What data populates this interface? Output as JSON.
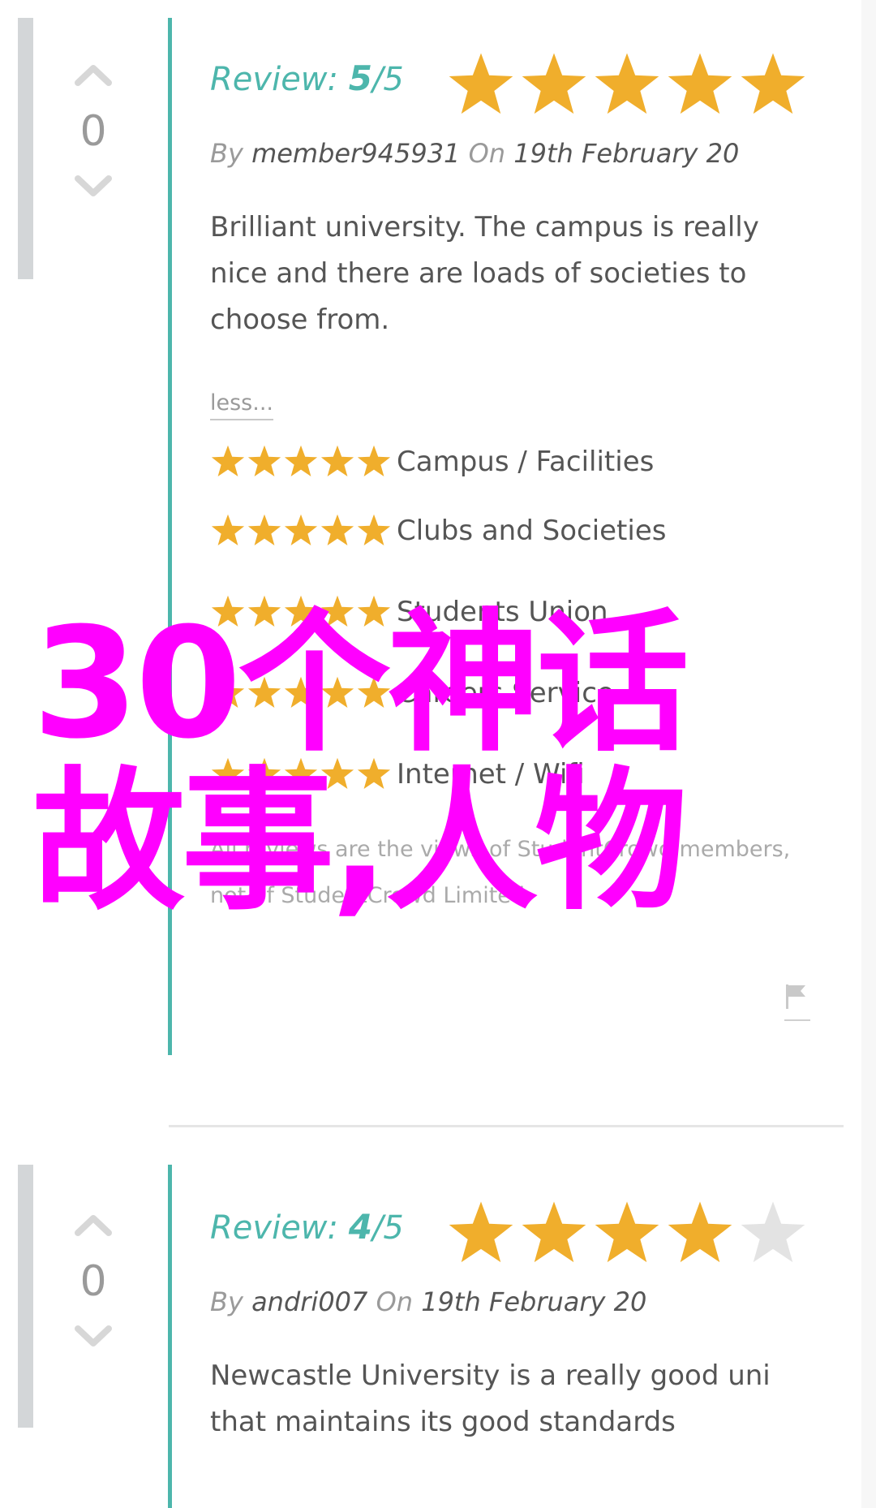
{
  "colors": {
    "accent": "#4db6ac",
    "star": "#f0ae2c",
    "star_empty": "#e3e3e3",
    "overlay": "#ff00ff"
  },
  "reviews": [
    {
      "votes": "0",
      "label": "Review:",
      "score": "5",
      "out_of": "/5",
      "rating": 5,
      "by": "By",
      "author": "member945931",
      "on": "On",
      "date": "19th February 20",
      "text": "Brilliant university. The campus is really nice and there are loads of societies to choose from.",
      "less": "less...",
      "categories": [
        {
          "label": "Campus / Facilities",
          "rating": 5
        },
        {
          "label": "Clubs and Societies",
          "rating": 5
        },
        {
          "label": "Students Union",
          "rating": 5
        },
        {
          "label": "Careers Service",
          "rating": 5
        },
        {
          "label": "Internet / Wifi",
          "rating": 5
        }
      ],
      "disclaimer": "All reviews are the views of StudentCrowd members, not of StudentCrowd Limited",
      "flag_icon": "flag-icon"
    },
    {
      "votes": "0",
      "label": "Review:",
      "score": "4",
      "out_of": "/5",
      "rating": 4,
      "by": "By",
      "author": "andri007",
      "on": "On",
      "date": "19th February 20",
      "text": "Newcastle University is a really good uni that maintains its good standards"
    }
  ],
  "overlay": {
    "line1": "30个神话",
    "line2": "故事,人物"
  }
}
